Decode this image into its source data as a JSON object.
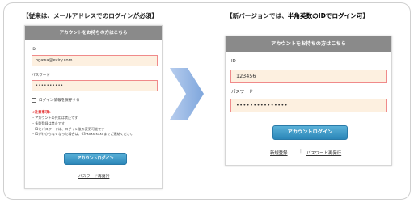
{
  "left_heading": "【従来は、メールアドレスでのログインが必須】",
  "right_heading": {
    "prefix": "【新バージョンでは、",
    "emphasis": "半角英数のIDでログイン可",
    "suffix": "】"
  },
  "old_form": {
    "title": "アカウントをお持ちの方はこちら",
    "id_label": "ID",
    "id_value": "ogawa@eviry.com",
    "password_label": "パスワード",
    "password_value": "••••••••••",
    "remember_label": "ログイン情報を保存する",
    "notes_title": "<注意事項>",
    "notes": [
      "・アカウントの共用は禁止です",
      "・多重登録は禁止です",
      "・IDとパスワードは、ログイン後の変更可能です",
      "・IDがわからなくなった場合は、03-xxxx-xxxxまでご連絡ください"
    ],
    "login_button": "アカウントログイン",
    "reissue_link": "パスワード再発行"
  },
  "new_form": {
    "title": "アカウントをお持ちの方はこちら",
    "id_label": "ID",
    "id_value": "123456",
    "password_label": "パスワード",
    "password_value": "•••••••••••••••",
    "login_button": "アカウントログイン",
    "register_link": "新規登録",
    "separator": "|",
    "reissue_link": "パスワード再発行"
  },
  "colors": {
    "panel_title_bg": "#8a8a8a",
    "field_bg": "#fdf0e0",
    "field_border": "#f08a8a",
    "button_blue": "#2b86b8",
    "arrow_blue": "#8fb4e3",
    "notes_red": "#e53a3a"
  },
  "icons": {
    "transition_arrow": "right-arrow-icon"
  }
}
